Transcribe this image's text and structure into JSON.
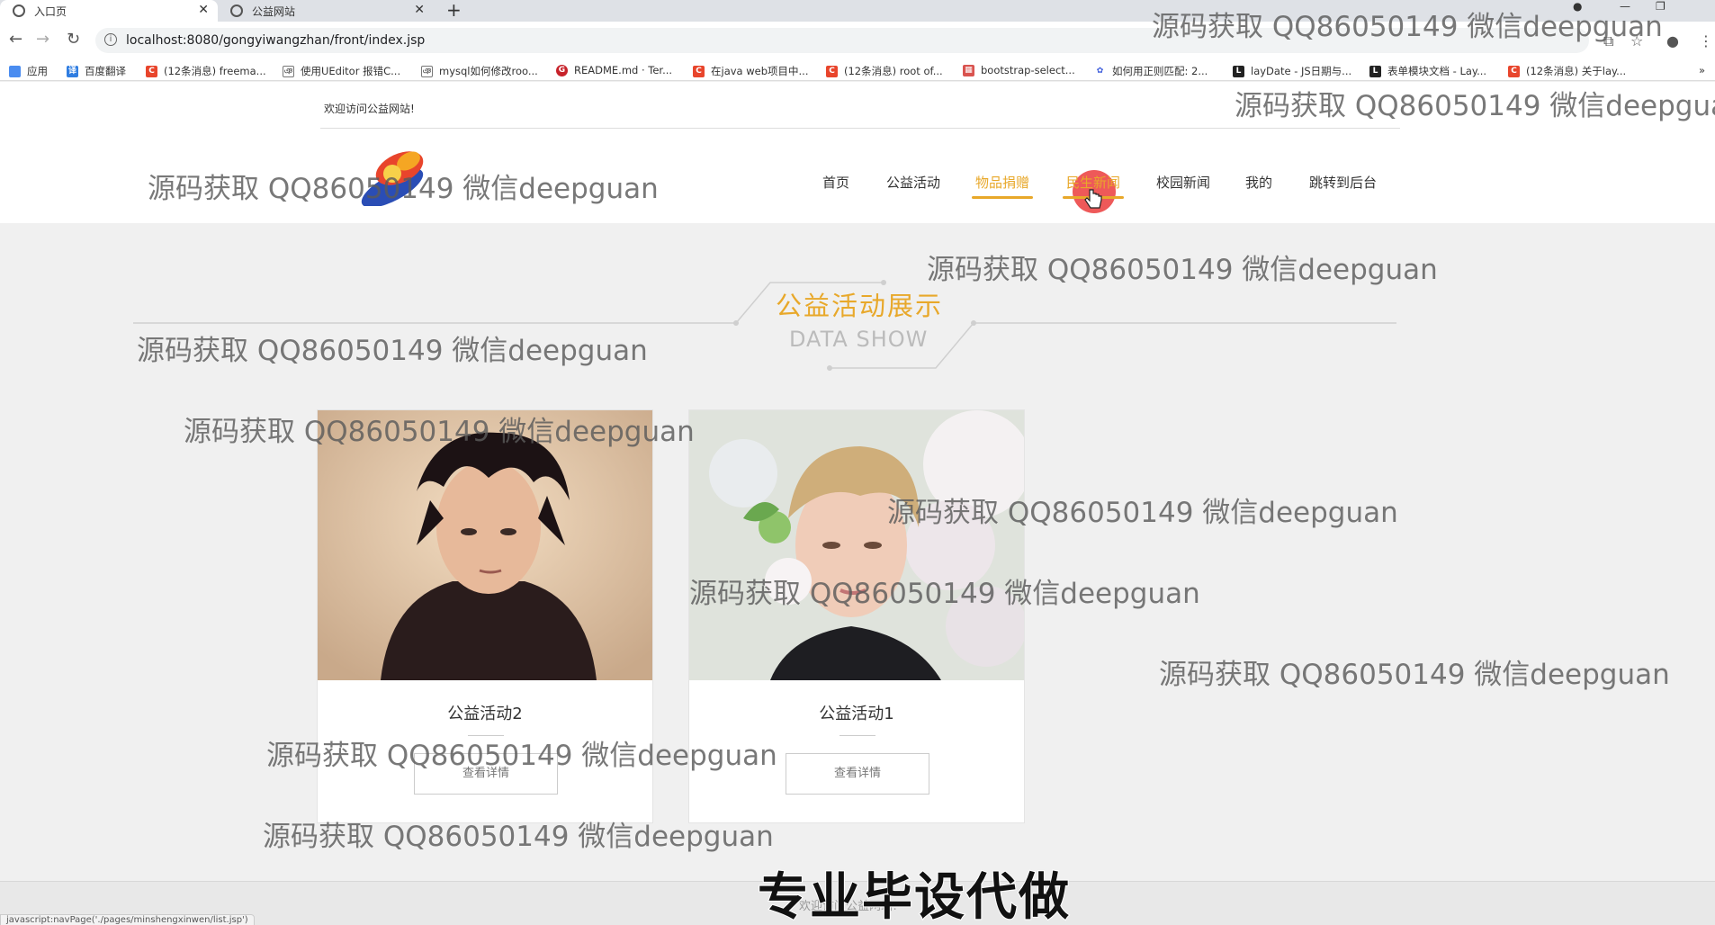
{
  "browser": {
    "tabs": [
      {
        "title": "入口页"
      },
      {
        "title": "公益网站"
      }
    ],
    "url": "localhost:8080/gongyiwangzhan/front/index.jsp",
    "bookmarks": [
      {
        "label": "应用",
        "color": "#4a8cf0",
        "icon": "apps-grid-icon"
      },
      {
        "label": "百度翻译",
        "color": "#2f7de1",
        "icon": "translate-icon"
      },
      {
        "label": "(12条消息) freema...",
        "color": "#e8452c",
        "icon": "csdn-icon"
      },
      {
        "label": "使用UEditor 报错C...",
        "color": "#555555",
        "icon": "cnblogs-icon"
      },
      {
        "label": "mysql如何修改roo...",
        "color": "#555555",
        "icon": "cnblogs-icon"
      },
      {
        "label": "README.md · Ter...",
        "color": "#c7222a",
        "icon": "gitee-icon"
      },
      {
        "label": "在java web项目中...",
        "color": "#e8452c",
        "icon": "csdn-icon"
      },
      {
        "label": "(12条消息) root of...",
        "color": "#e8452c",
        "icon": "csdn-icon"
      },
      {
        "label": "bootstrap-select...",
        "color": "#d9534f",
        "icon": "bookmark-icon"
      },
      {
        "label": "如何用正则匹配: 2...",
        "color": "#3b5bdb",
        "icon": "baidu-icon"
      },
      {
        "label": "layDate - JS日期与...",
        "color": "#222222",
        "icon": "layui-icon"
      },
      {
        "label": "表单模块文档 - Lay...",
        "color": "#222222",
        "icon": "layui-icon"
      },
      {
        "label": "(12条消息) 关于lay...",
        "color": "#e8452c",
        "icon": "csdn-icon"
      }
    ],
    "status_url": "javascript:navPage('./pages/minshengxinwen/list.jsp')"
  },
  "site": {
    "welcome": "欢迎访问公益网站!",
    "nav": [
      {
        "label": "首页"
      },
      {
        "label": "公益活动"
      },
      {
        "label": "物品捐赠"
      },
      {
        "label": "民生新闻"
      },
      {
        "label": "校园新闻"
      },
      {
        "label": "我的"
      },
      {
        "label": "跳转到后台"
      }
    ],
    "section": {
      "title": "公益活动展示",
      "subtitle": "DATA SHOW"
    },
    "cards": [
      {
        "title": "公益活动2",
        "button": "查看详情"
      },
      {
        "title": "公益活动1",
        "button": "查看详情"
      }
    ],
    "footer": "欢迎访问公益网站!",
    "colors": {
      "accent": "#e8a82a",
      "background": "#f0f0f0"
    }
  },
  "overlay": {
    "watermark": "源码获取 QQ86050149 微信deepguan",
    "caption": "专业毕设代做"
  }
}
